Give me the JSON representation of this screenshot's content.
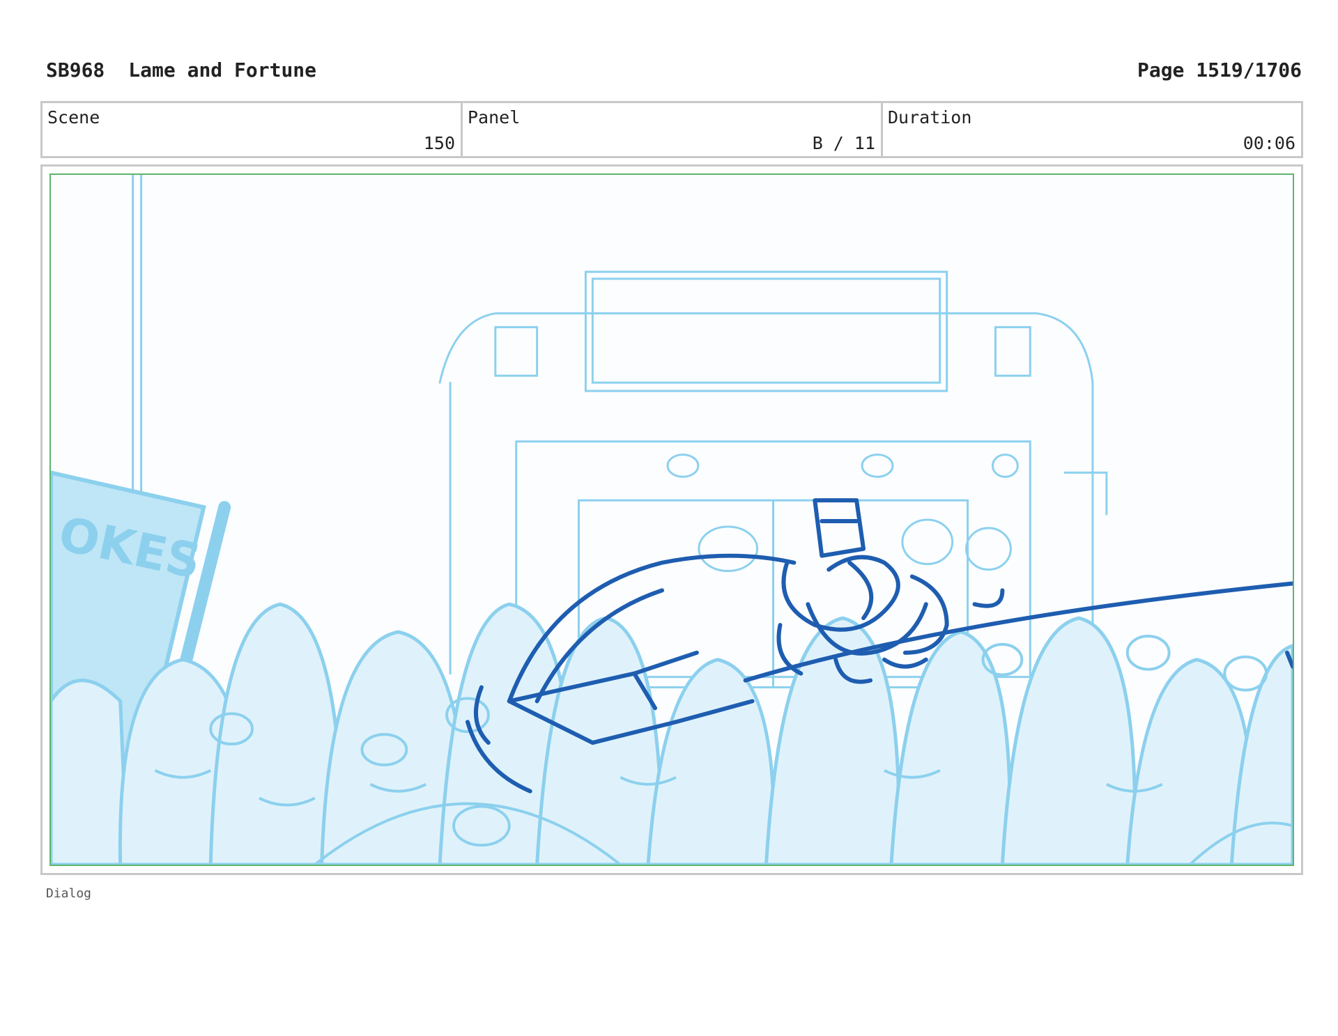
{
  "header": {
    "code": "SB968",
    "title": "Lame and Fortune",
    "page": "Page 1519/1706"
  },
  "info": {
    "scene_label": "Scene",
    "scene_value": "150",
    "panel_label": "Panel",
    "panel_value": "B / 11",
    "duration_label": "Duration",
    "duration_value": "00:06"
  },
  "panel": {
    "sign_text": "OKES",
    "sketch_colors": {
      "background_lines": "#8cd0ee",
      "foreground_lines": "#1e5db0",
      "frame": "#5db56f"
    }
  },
  "footer": {
    "dialog_label": "Dialog"
  }
}
